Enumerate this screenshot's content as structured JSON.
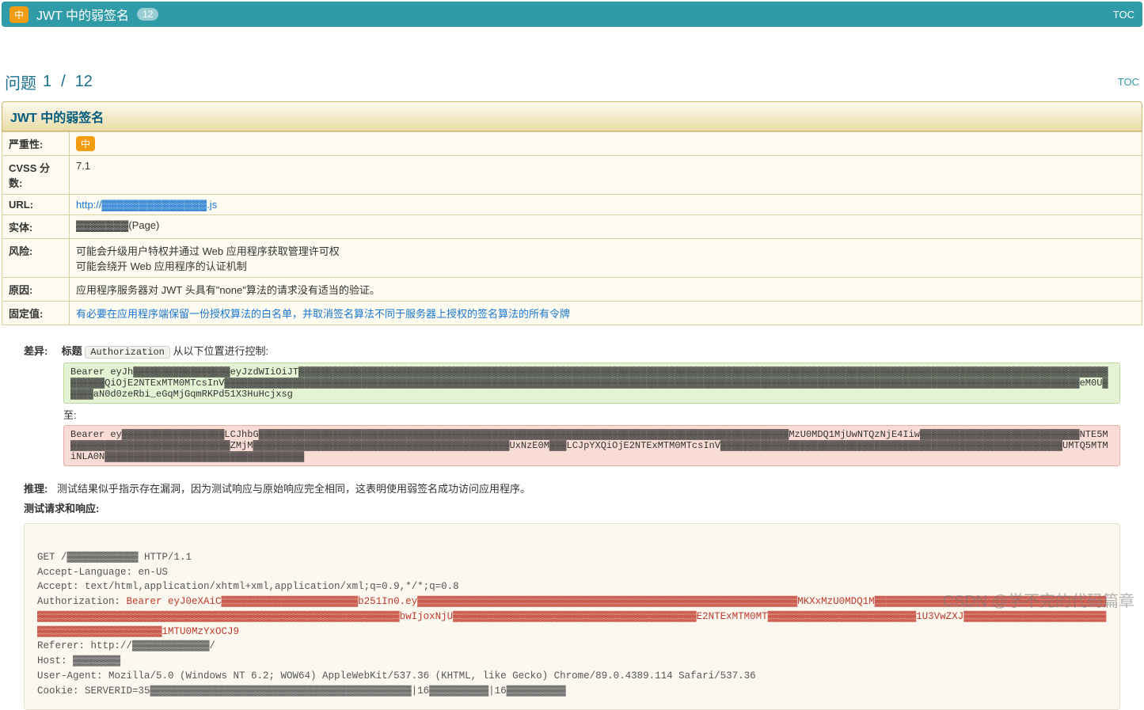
{
  "topbar": {
    "severity_badge": "中",
    "title": "JWT 中的弱签名",
    "count": "12",
    "toc": "TOC"
  },
  "nav": {
    "label": "问题",
    "current": "1",
    "sep": "/",
    "total": "12",
    "toc": "TOC"
  },
  "issue_title": "JWT 中的弱签名",
  "meta": {
    "severity_k": "严重性:",
    "severity_v": "中",
    "cvss_k": "CVSS 分数:",
    "cvss_v": "7.1",
    "url_k": "URL:",
    "url_v": "http://▓▓▓▓▓▓▓▓▓▓▓▓▓▓.js",
    "entity_k": "实体:",
    "entity_v": "▓▓▓▓▓▓▓(Page)",
    "risk_k": "风险:",
    "risk_v1": "可能会升级用户特权并通过 Web 应用程序获取管理许可权",
    "risk_v2": "可能会绕开 Web 应用程序的认证机制",
    "cause_k": "原因:",
    "cause_v": "应用程序服务器对 JWT 头具有\"none\"算法的请求没有适当的验证。",
    "fix_k": "固定值:",
    "fix_v": "有必要在应用程序端保留一份授权算法的白名单，并取消签名算法不同于服务器上授权的签名算法的所有令牌"
  },
  "diff": {
    "label": "差异:",
    "header_word": "标题",
    "header_chip": "Authorization",
    "header_tail": "从以下位置进行控制:",
    "from": "Bearer eyJh▓▓▓▓▓▓▓▓▓▓▓▓▓▓▓▓▓eyJzdWIiOiJT▓▓▓▓▓▓▓▓▓▓▓▓▓▓▓▓▓▓▓▓▓▓▓▓▓▓▓▓▓▓▓▓▓▓▓▓▓▓▓▓▓▓▓▓▓▓▓▓▓▓▓▓▓▓▓▓▓▓▓▓▓▓▓▓▓▓▓▓▓▓▓▓▓▓▓▓▓▓▓▓▓▓▓▓▓▓▓▓▓▓▓▓▓▓▓▓▓▓▓▓▓▓▓▓▓▓▓▓▓▓▓▓▓▓▓▓▓▓▓▓▓▓▓▓▓▓▓▓▓▓▓▓▓▓▓▓▓▓▓▓▓▓▓▓▓▓▓▓QiOjE2NTExMTM0MTcsInV▓▓▓▓▓▓▓▓▓▓▓▓▓▓▓▓▓▓▓▓▓▓▓▓▓▓▓▓▓▓▓▓▓▓▓▓▓▓▓▓▓▓▓▓▓▓▓▓▓▓▓▓▓▓▓▓▓▓▓▓▓▓▓▓▓▓▓▓▓▓▓▓▓▓▓▓▓▓▓▓▓▓▓▓▓▓▓▓▓▓▓▓▓▓▓▓▓▓▓▓▓▓▓▓▓▓▓▓▓▓▓▓▓▓▓▓▓▓▓▓▓▓▓▓▓▓▓▓▓▓▓▓▓▓▓▓▓▓▓▓▓▓▓▓▓▓▓▓▓▓eM0U▓▓▓▓▓aN0d0zeRbi_eGqMjGqmRKPd51X3HuHcjxsg",
    "to_label": "至:",
    "to": "Bearer ey▓▓▓▓▓▓▓▓▓▓▓▓▓▓▓▓▓▓LCJhbG▓▓▓▓▓▓▓▓▓▓▓▓▓▓▓▓▓▓▓▓▓▓▓▓▓▓▓▓▓▓▓▓▓▓▓▓▓▓▓▓▓▓▓▓▓▓▓▓▓▓▓▓▓▓▓▓▓▓▓▓▓▓▓▓▓▓▓▓▓▓▓▓▓▓▓▓▓▓▓▓▓▓▓▓▓▓▓▓▓▓▓▓▓MzU0MDQ1MjUwNTQzNjE4Iiw▓▓▓▓▓▓▓▓▓▓▓▓▓▓▓▓▓▓▓▓▓▓▓▓▓▓▓▓NTE5M▓▓▓▓▓▓▓▓▓▓▓▓▓▓▓▓▓▓▓▓▓▓▓▓▓▓▓▓ZMjM▓▓▓▓▓▓▓▓▓▓▓▓▓▓▓▓▓▓▓▓▓▓▓▓▓▓▓▓▓▓▓▓▓▓▓▓▓▓▓▓▓▓▓▓▓UxNzE0M▓▓▓LCJpYXQiOjE2NTExMTM0MTcsInV▓▓▓▓▓▓▓▓▓▓▓▓▓▓▓▓▓▓▓▓▓▓▓▓▓▓▓▓▓▓▓▓▓▓▓▓▓▓▓▓▓▓▓▓▓▓▓▓▓▓▓▓▓▓▓▓▓▓▓▓UMTQ5MTMiNLA0N▓▓▓▓▓▓▓▓▓▓▓▓▓▓▓▓▓▓▓▓▓▓▓▓▓▓▓▓▓▓▓▓▓▓▓"
  },
  "reasoning": {
    "label": "推理:",
    "text": "测试结果似乎指示存在漏洞，因为测试响应与原始响应完全相同，这表明使用弱签名成功访问应用程序。"
  },
  "rr_label": "测试请求和响应:",
  "http": {
    "l1": "GET /▓▓▓▓▓▓▓▓▓▓▓▓ HTTP/1.1",
    "l2": "Accept-Language: en-US",
    "l3": "Accept: text/html,application/xhtml+xml,application/xml;q=0.9,*/*;q=0.8",
    "l4a": "Authorization: ",
    "l4b": "Bearer eyJ0eXAiC▓▓▓▓▓▓▓▓▓▓▓▓▓▓▓▓▓▓▓▓▓▓▓b251In0.ey▓▓▓▓▓▓▓▓▓▓▓▓▓▓▓▓▓▓▓▓▓▓▓▓▓▓▓▓▓▓▓▓▓▓▓▓▓▓▓▓▓▓▓▓▓▓▓▓▓▓▓▓▓▓▓▓▓▓▓▓▓▓▓▓MKXxMzU0MDQ1M▓▓▓▓▓▓▓▓▓▓▓▓▓▓▓▓▓▓▓▓▓▓▓▓▓▓▓▓▓▓▓▓▓▓▓▓▓▓▓▓▓▓▓▓▓▓▓▓▓▓▓▓▓▓▓▓▓▓▓▓▓▓▓▓▓▓▓▓▓▓▓▓▓▓▓▓▓▓▓▓▓▓▓▓▓▓▓▓▓▓▓▓▓▓▓▓▓▓▓▓bwIjoxNjU▓▓▓▓▓▓▓▓▓▓▓▓▓▓▓▓▓▓▓▓▓▓▓▓▓▓▓▓▓▓▓▓▓▓▓▓▓▓▓▓▓E2NTExMTM0MT▓▓▓▓▓▓▓▓▓▓▓▓▓▓▓▓▓▓▓▓▓▓▓▓▓1U3VwZXJ▓▓▓▓▓▓▓▓▓▓▓▓▓▓▓▓▓▓▓▓▓▓▓▓▓▓▓▓▓▓▓▓▓▓▓▓▓▓▓▓▓▓▓▓▓1MTU0MzYxOCJ9",
    "l5": "Referer: http://▓▓▓▓▓▓▓▓▓▓▓▓▓/",
    "l6": "Host: ▓▓▓▓▓▓▓▓",
    "l7": "User-Agent: Mozilla/5.0 (Windows NT 6.2; WOW64) AppleWebKit/537.36 (KHTML, like Gecko) Chrome/89.0.4389.114 Safari/537.36",
    "l8": "Cookie: SERVERID=35▓▓▓▓▓▓▓▓▓▓▓▓▓▓▓▓▓▓▓▓▓▓▓▓▓▓▓▓▓▓▓▓▓▓▓▓▓▓▓▓▓▓▓▓|16▓▓▓▓▓▓▓▓▓▓|16▓▓▓▓▓▓▓▓▓▓"
  },
  "watermark": "CSDN @学不完的代码篇章"
}
